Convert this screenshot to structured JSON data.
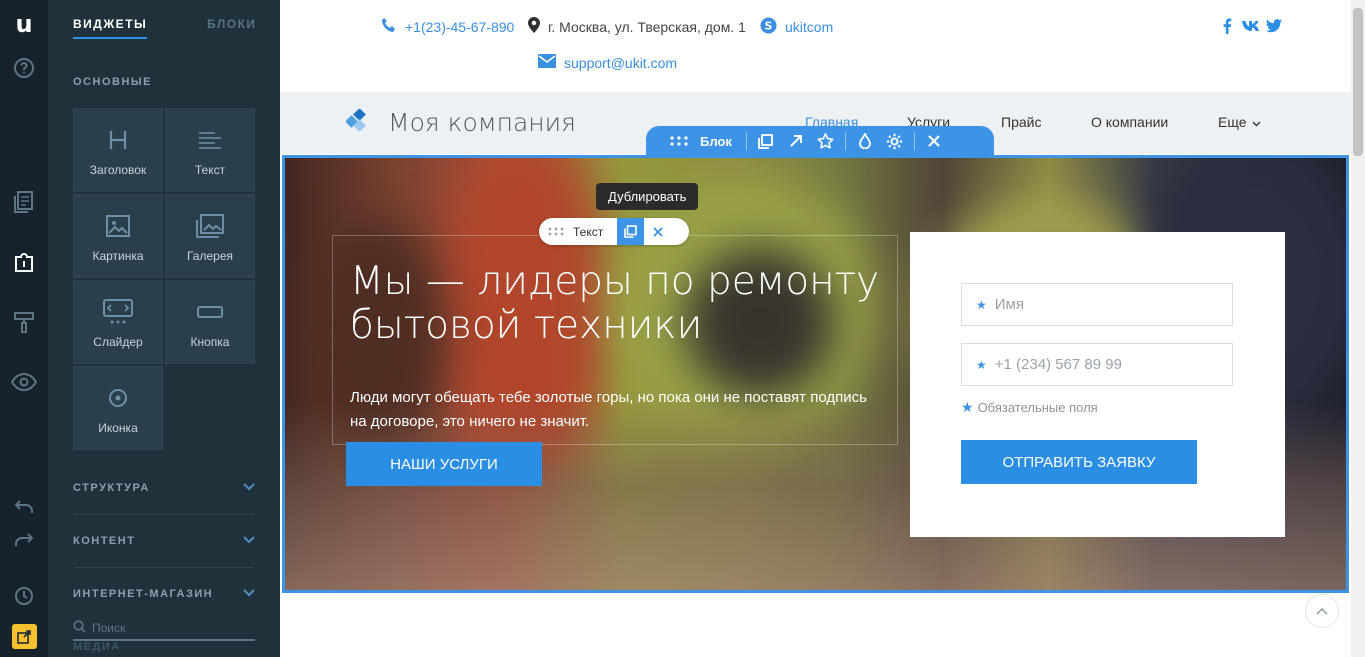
{
  "rail": {
    "logo": "u",
    "icons": [
      "help-icon",
      "pages-icon",
      "widgets-icon",
      "design-brush-icon",
      "preview-eye-icon",
      "undo-icon",
      "redo-icon",
      "history-icon",
      "publish-icon"
    ]
  },
  "panel": {
    "tabs": {
      "widgets": "ВИДЖЕТЫ",
      "blocks": "БЛОКИ"
    },
    "basic_title": "ОСНОВНЫЕ",
    "widgets": [
      {
        "label": "Заголовок",
        "icon": "heading-icon"
      },
      {
        "label": "Текст",
        "icon": "text-icon"
      },
      {
        "label": "Картинка",
        "icon": "image-icon"
      },
      {
        "label": "Галерея",
        "icon": "gallery-icon"
      },
      {
        "label": "Слайдер",
        "icon": "slider-icon"
      },
      {
        "label": "Кнопка",
        "icon": "button-icon"
      },
      {
        "label": "Иконка",
        "icon": "icon-widget-icon"
      }
    ],
    "sections": [
      "СТРУКТУРА",
      "КОНТЕНТ",
      "ИНТЕРНЕТ-МАГАЗИН"
    ],
    "search_placeholder": "Поиск",
    "media": "МЕДИА"
  },
  "topbar": {
    "phone": "+1(23)-45-67-890",
    "address": "г. Москва, ул. Тверская, дом. 1",
    "skype": "ukitcom",
    "email": "support@ukit.com",
    "social": {
      "facebook": "f",
      "vk": "vk",
      "twitter": "twitter"
    }
  },
  "header": {
    "brand": "Моя компания",
    "nav": [
      "Главная",
      "Услуги",
      "Прайс",
      "О компании",
      "Еще"
    ],
    "active_nav": "Главная"
  },
  "block_toolbar": {
    "label": "Блок"
  },
  "hero": {
    "tooltip": "Дублировать",
    "text_toolbar_label": "Текст",
    "title": "Мы — лидеры по ремонту бытовой техники",
    "subtitle": "Люди могут обещать тебе золотые горы, но пока они не поставят подпись на договоре, это ничего не значит.",
    "button": "НАШИ УСЛУГИ"
  },
  "form": {
    "name_placeholder": "Имя",
    "phone_placeholder": "+1 (234) 567 89 99",
    "required_note": "Обязательные поля",
    "submit": "ОТПРАВИТЬ ЗАЯВКУ"
  },
  "colors": {
    "accent": "#2b8ee5",
    "rail": "#16232c",
    "panel": "#20313c",
    "highlight_yellow": "#f8c22f"
  }
}
